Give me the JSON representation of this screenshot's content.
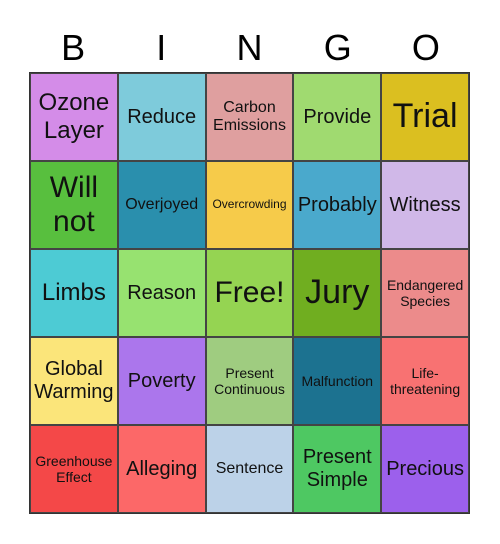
{
  "title_letters": [
    "B",
    "I",
    "N",
    "G",
    "O"
  ],
  "cells": [
    {
      "text": "Ozone Layer",
      "color": "#d48ce8",
      "size": "fs-xl"
    },
    {
      "text": "Reduce",
      "color": "#7ecbdb",
      "size": "fs-l"
    },
    {
      "text": "Carbon Emissions",
      "color": "#df9f9f",
      "size": "fs-m"
    },
    {
      "text": "Provide",
      "color": "#a0da70",
      "size": "fs-l"
    },
    {
      "text": "Trial",
      "color": "#dbbf20",
      "size": "fs-big"
    },
    {
      "text": "Will not",
      "color": "#58bf3e",
      "size": "fs-xxl"
    },
    {
      "text": "Overjoyed",
      "color": "#2a8fad",
      "size": "fs-m"
    },
    {
      "text": "Overcrowding",
      "color": "#f6cb4a",
      "size": "fs-xs"
    },
    {
      "text": "Probably",
      "color": "#4aa9cc",
      "size": "fs-l"
    },
    {
      "text": "Witness",
      "color": "#d0b8e8",
      "size": "fs-l"
    },
    {
      "text": "Limbs",
      "color": "#4dcbd4",
      "size": "fs-xl"
    },
    {
      "text": "Reason",
      "color": "#97e270",
      "size": "fs-l"
    },
    {
      "text": "Free!",
      "color": "#95d452",
      "size": "fs-xxl"
    },
    {
      "text": "Jury",
      "color": "#70ae20",
      "size": "fs-big"
    },
    {
      "text": "Endangered Species",
      "color": "#ec8b8b",
      "size": "fs-s"
    },
    {
      "text": "Global Warming",
      "color": "#fbe57a",
      "size": "fs-l"
    },
    {
      "text": "Poverty",
      "color": "#ab76ec",
      "size": "fs-l"
    },
    {
      "text": "Present Continuous",
      "color": "#9fcc80",
      "size": "fs-s"
    },
    {
      "text": "Malfunction",
      "color": "#1c7290",
      "size": "fs-s"
    },
    {
      "text": "Life-threatening",
      "color": "#f87272",
      "size": "fs-s"
    },
    {
      "text": "Greenhouse Effect",
      "color": "#f44848",
      "size": "fs-s"
    },
    {
      "text": "Alleging",
      "color": "#fc6868",
      "size": "fs-l"
    },
    {
      "text": "Sentence",
      "color": "#bcd2e8",
      "size": "fs-m"
    },
    {
      "text": "Present Simple",
      "color": "#4ec862",
      "size": "fs-l"
    },
    {
      "text": "Precious",
      "color": "#9c60ec",
      "size": "fs-l"
    }
  ]
}
